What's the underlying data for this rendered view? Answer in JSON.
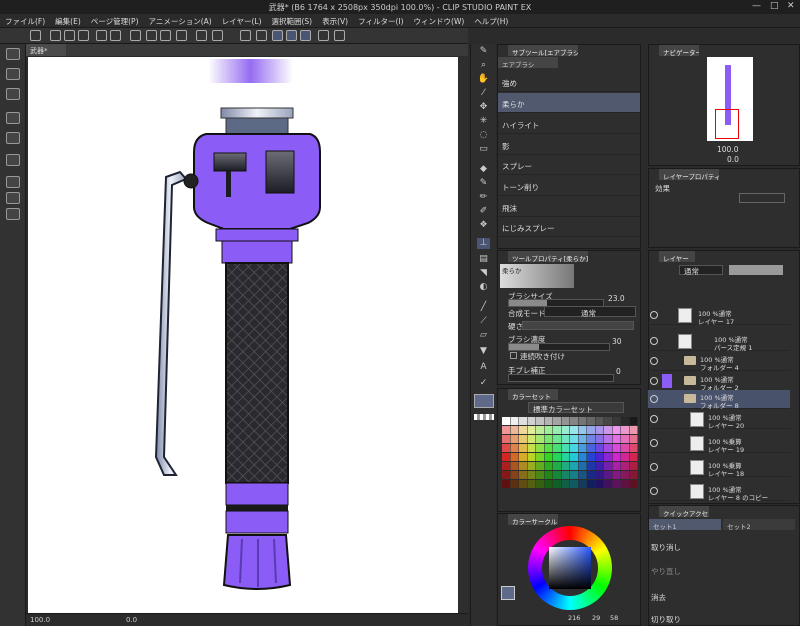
{
  "window": {
    "title": "武器* (B6 1764 x 2508px 350dpi 100.0%) - CLIP STUDIO PAINT EX",
    "controls": [
      "—",
      "□",
      "✕"
    ]
  },
  "menu": [
    "ファイル(F)",
    "編集(E)",
    "ページ管理(P)",
    "アニメーション(A)",
    "レイヤー(L)",
    "選択範囲(S)",
    "表示(V)",
    "フィルター(I)",
    "ウィンドウ(W)",
    "ヘルプ(H)"
  ],
  "document": {
    "tab_label": "武器*",
    "zoom_value": "100.0",
    "angle_value": "0.0"
  },
  "sub_tool": {
    "panel_tab": "サブツール[エアブラシ]",
    "group_tab": "エアブラシ",
    "items": [
      "強め",
      "柔らか",
      "ハイライト",
      "影",
      "スプレー",
      "トーン削り",
      "飛沫",
      "にじみスプレー"
    ],
    "selected_index": 1
  },
  "tool_property": {
    "panel_tab": "ツールプロパティ[柔らか]",
    "preview_label": "柔らか",
    "brush_size_label": "ブラシサイズ",
    "brush_size_value": "23.0",
    "blend_mode_label": "合成モード",
    "blend_mode_value": "通常",
    "hardness_label": "硬さ",
    "density_label": "ブラシ濃度",
    "density_value": "30",
    "continuous_label": "連続吹き付け",
    "stabilization_label": "手ブレ補正",
    "stabilization_value": "0"
  },
  "color_set": {
    "panel_tab": "カラーセット",
    "set_name": "標準カラーセット"
  },
  "color_wheel": {
    "panel_tab": "カラーサークル",
    "h_value": "216",
    "s_value": "29",
    "v_value": "58",
    "main_color": "#5f6a8a"
  },
  "navigator": {
    "panel_tab": "ナビゲーター",
    "zoom_value": "100.0",
    "angle_value": "0.0"
  },
  "layer_property": {
    "panel_tab": "レイヤープロパティ",
    "effect_label": "効果"
  },
  "layers": {
    "panel_tab": "レイヤー",
    "blend_mode": "通常",
    "opacity": "100",
    "items": [
      {
        "line1": "100 %通常",
        "line2": "レイヤー 17",
        "kind": "layer"
      },
      {
        "line1": "100 %通常",
        "line2": "パース定規 1",
        "kind": "ruler"
      },
      {
        "line1": "100 %通常",
        "line2": "フォルダー 4",
        "kind": "folder"
      },
      {
        "line1": "100 %通常",
        "line2": "フォルダー 2",
        "kind": "folder"
      },
      {
        "line1": "100 %通常",
        "line2": "フォルダー 8",
        "kind": "folder",
        "selected": true
      },
      {
        "line1": "100 %通常",
        "line2": "レイヤー 20",
        "kind": "layer"
      },
      {
        "line1": "100 %乗算",
        "line2": "レイヤー 19",
        "kind": "layer"
      },
      {
        "line1": "100 %乗算",
        "line2": "レイヤー 18",
        "kind": "layer"
      },
      {
        "line1": "100 %通常",
        "line2": "レイヤー 8 のコピー",
        "kind": "layer"
      }
    ]
  },
  "quick_access": {
    "panel_tab": "クイックアクセス",
    "set_tabs": [
      "セット1",
      "セット2"
    ],
    "items": [
      "取り消し",
      "やり直し",
      "消去",
      "切り取り"
    ]
  },
  "colors": {
    "accent": "#8b5cf6",
    "panel_bg": "#2e2e2e",
    "selection": "#50596e"
  }
}
